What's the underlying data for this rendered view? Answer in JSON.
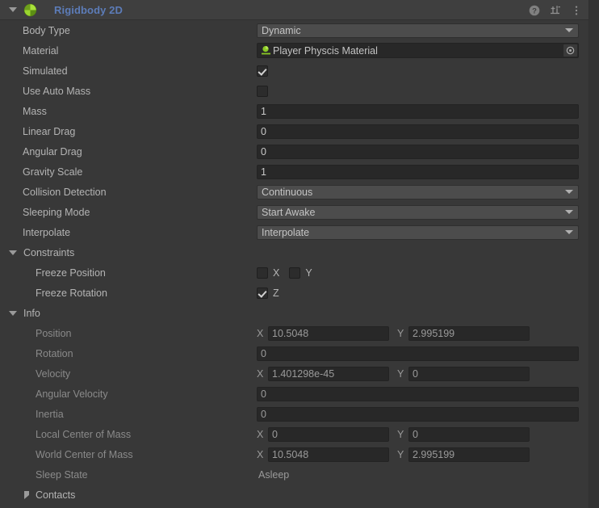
{
  "component": {
    "title": "Rigidbody 2D",
    "icon": "rigidbody2d-icon",
    "expanded": true,
    "header_icons": [
      {
        "name": "help-icon",
        "label": "?"
      },
      {
        "name": "preset-icon",
        "label": "Preset"
      },
      {
        "name": "more-menu-icon",
        "label": "More"
      }
    ]
  },
  "colors": {
    "panel_bg": "#383838",
    "header_bg": "#3f3f3f",
    "title_blue": "#5c7cb8",
    "field_bg": "#282828",
    "popup_bg": "#4c4c4c",
    "label": "#b4b4b4",
    "label_dim": "#8a8a8a",
    "accent_green": "#8ac926"
  },
  "properties": {
    "body_type": {
      "label": "Body Type",
      "value": "Dynamic"
    },
    "material": {
      "label": "Material",
      "value": "Player Physcis Material"
    },
    "simulated": {
      "label": "Simulated",
      "checked": true
    },
    "use_auto_mass": {
      "label": "Use Auto Mass",
      "checked": false
    },
    "mass": {
      "label": "Mass",
      "value": "1"
    },
    "linear_drag": {
      "label": "Linear Drag",
      "value": "0"
    },
    "angular_drag": {
      "label": "Angular Drag",
      "value": "0"
    },
    "gravity_scale": {
      "label": "Gravity Scale",
      "value": "1"
    },
    "collision_detection": {
      "label": "Collision Detection",
      "value": "Continuous"
    },
    "sleeping_mode": {
      "label": "Sleeping Mode",
      "value": "Start Awake"
    },
    "interpolate": {
      "label": "Interpolate",
      "value": "Interpolate"
    }
  },
  "constraints": {
    "title": "Constraints",
    "expanded": true,
    "freeze_position": {
      "label": "Freeze Position",
      "x": {
        "caption": "X",
        "checked": false
      },
      "y": {
        "caption": "Y",
        "checked": false
      }
    },
    "freeze_rotation": {
      "label": "Freeze Rotation",
      "z": {
        "caption": "Z",
        "checked": true
      }
    }
  },
  "info": {
    "title": "Info",
    "expanded": true,
    "position": {
      "label": "Position",
      "x_axis": "X",
      "x": "10.5048",
      "y_axis": "Y",
      "y": "2.995199"
    },
    "rotation": {
      "label": "Rotation",
      "value": "0"
    },
    "velocity": {
      "label": "Velocity",
      "x_axis": "X",
      "x": "1.401298e-45",
      "y_axis": "Y",
      "y": "0"
    },
    "angular_velocity": {
      "label": "Angular Velocity",
      "value": "0"
    },
    "inertia": {
      "label": "Inertia",
      "value": "0"
    },
    "local_center_of_mass": {
      "label": "Local Center of Mass",
      "x_axis": "X",
      "x": "0",
      "y_axis": "Y",
      "y": "0"
    },
    "world_center_of_mass": {
      "label": "World Center of Mass",
      "x_axis": "X",
      "x": "10.5048",
      "y_axis": "Y",
      "y": "2.995199"
    },
    "sleep_state": {
      "label": "Sleep State",
      "value": "Asleep"
    },
    "contacts": {
      "label": "Contacts",
      "expanded": false
    }
  }
}
